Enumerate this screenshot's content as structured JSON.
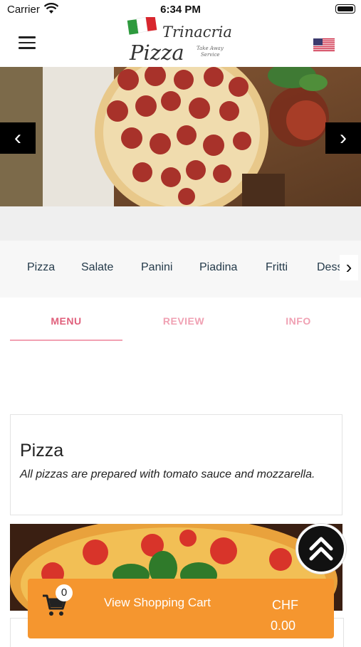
{
  "status_bar": {
    "carrier": "Carrier",
    "time": "6:34 PM"
  },
  "header": {
    "menu_icon": "hamburger-icon",
    "logo": {
      "line1": "Trinacria",
      "line2": "Pizza",
      "tagline": "Take Away Service"
    },
    "language_flag": "us-flag-icon"
  },
  "carousel": {
    "prev_icon": "chevron-left-icon",
    "next_icon": "chevron-right-icon"
  },
  "categories": {
    "items": [
      "Pizza",
      "Salate",
      "Panini",
      "Piadina",
      "Fritti",
      "Dessert"
    ],
    "next_icon": "chevron-right-icon"
  },
  "tabs": [
    {
      "label": "MENU",
      "active": true
    },
    {
      "label": "REVIEW",
      "active": false
    },
    {
      "label": "INFO",
      "active": false
    }
  ],
  "section": {
    "title": "Pizza",
    "description": "All pizzas are prepared with tomato sauce and mozzarella."
  },
  "scroll_top_icon": "double-chevron-up-icon",
  "cart": {
    "count": "0",
    "label": "View Shopping Cart",
    "currency": "CHF",
    "total": "0.00",
    "icon": "shopping-cart-icon"
  },
  "colors": {
    "accent_pink": "#e0607c",
    "cart_orange": "#f5962f",
    "category_text": "#243a4a"
  }
}
